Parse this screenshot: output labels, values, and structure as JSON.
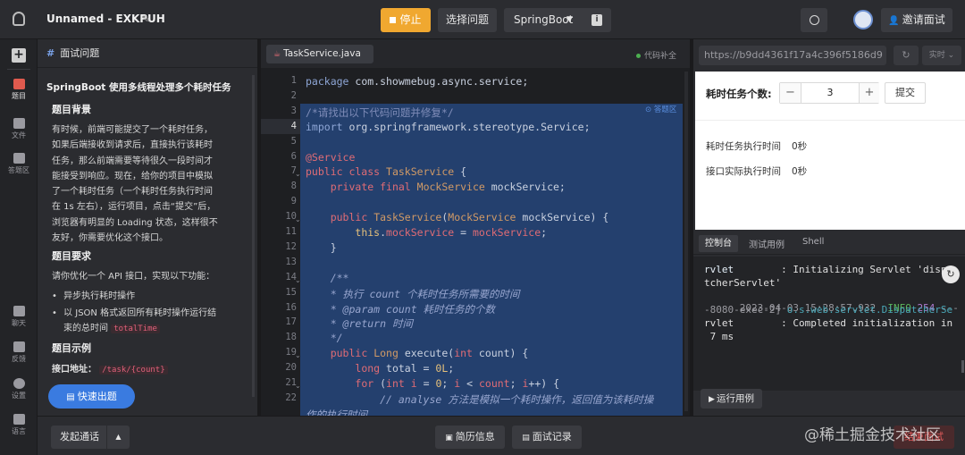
{
  "topbar": {
    "title": "Unnamed - EXKPUH",
    "stop_label": "停止",
    "select_problem_label": "选择问题",
    "language_label": "SpringBoot",
    "invite_label": "邀请面试"
  },
  "rail": {
    "items": [
      {
        "label": "题目"
      },
      {
        "label": "文件"
      },
      {
        "label": "答题区"
      },
      {
        "label": "聊天"
      },
      {
        "label": "反馈"
      },
      {
        "label": "设置"
      },
      {
        "label": "语言"
      }
    ]
  },
  "problem": {
    "header": "面试问题",
    "title": "SpringBoot 使用多线程处理多个耗时任务",
    "bg_heading": "题目背景",
    "bg_lines": [
      "有时候，前端可能提交了一个耗时任务，",
      "如果后端接收到请求后，直接执行该耗时",
      "任务，那么前端需要等待很久一段时间才",
      "能接受到响应。现在，给你的项目中模拟",
      "了一个耗时任务（一个耗时任务执行时间",
      "在 1s 左右），运行项目，点击“提交”后，",
      "浏览器有明显的 Loading 状态，这样很不",
      "友好，你需要优化这个接口。"
    ],
    "req_heading": "题目要求",
    "req_intro": "请你优化一个 API 接口，实现以下功能：",
    "req_item1": "异步执行耗时操作",
    "req_item2_line1": "以 JSON 格式返回所有耗时操作运行结",
    "req_item2_line2": "束的总时间",
    "req_item2_code": "totalTime",
    "example_heading": "题目示例",
    "api_label": "接口地址：",
    "api_path": "/task/{count}",
    "quick_button": "快速出题"
  },
  "editor": {
    "tab_label": "TaskService.java",
    "completion_label": "代码补全",
    "answer_area_label": "答题区",
    "lines": [
      {
        "n": "1",
        "html": "<span class='pk'>package</span> com.showmebug.async.service;"
      },
      {
        "n": "2",
        "html": ""
      },
      {
        "n": "3",
        "html": "<span class='cm'>/*请找出以下代码问题并修复*/</span>"
      },
      {
        "n": "4",
        "html": "<span class='pk'>import</span> org.springframework.stereotype.Service;"
      },
      {
        "n": "5",
        "html": ""
      },
      {
        "n": "6",
        "html": "<span class='an'>@Service</span>"
      },
      {
        "n": "7",
        "html": "<span class='kw'>public class</span> <span class='ty'>TaskService</span> {"
      },
      {
        "n": "8",
        "html": "    <span class='kw'>private final</span> <span class='ty'>MockService</span> mockService;"
      },
      {
        "n": "9",
        "html": ""
      },
      {
        "n": "10",
        "html": "    <span class='kw'>public</span> <span class='ty'>TaskService</span>(<span class='ty'>MockService</span> mockService) {"
      },
      {
        "n": "11",
        "html": "        <span class='pm'>this</span>.<span class='fd'>mockService</span> = <span class='fd'>mockService</span>;"
      },
      {
        "n": "12",
        "html": "    }"
      },
      {
        "n": "13",
        "html": ""
      },
      {
        "n": "14",
        "html": "    <span class='cmt'>/**</span>"
      },
      {
        "n": "15",
        "html": "    <span class='cmt'>* 执行 count 个耗时任务所需要的时间</span>"
      },
      {
        "n": "16",
        "html": "    <span class='cmt'>* @param count 耗时任务的个数</span>"
      },
      {
        "n": "17",
        "html": "    <span class='cmt'>* @return 时间</span>"
      },
      {
        "n": "18",
        "html": "    <span class='cmt'>*/</span>"
      },
      {
        "n": "19",
        "html": "    <span class='kw'>public</span> <span class='ty'>Long</span> execute(<span class='kw'>int</span> count) {"
      },
      {
        "n": "20",
        "html": "        <span class='kw'>long</span> total = <span class='nu'>0L</span>;"
      },
      {
        "n": "21",
        "html": "        <span class='kw'>for</span> (<span class='kw'>int</span> <span class='fd'>i</span> = <span class='nu'>0</span>; <span class='fd'>i</span> &lt; <span class='fd'>count</span>; <span class='fd'>i</span>++) {"
      },
      {
        "n": "22",
        "html": "            <span class='cmt'>// analyse 方法是模拟一个耗时操作，返回值为该耗时操</span>"
      },
      {
        "n": "",
        "html": "<span class='cmt'>作的执行时间</span>"
      }
    ]
  },
  "preview": {
    "url": "https://b9dd4361f17a4c396f5186d9",
    "realtime_label": "实时",
    "count_label": "耗时任务个数:",
    "count_value": "3",
    "minus": "−",
    "plus": "+",
    "submit_label": "提交",
    "exec_time_label": "耗时任务执行时间",
    "exec_time_value": "0秒",
    "actual_time_label": "接口实际执行时间",
    "actual_time_value": "0秒"
  },
  "console": {
    "tabs": [
      "控制台",
      "测试用例",
      "Shell"
    ],
    "line1": "rvlet        : Initializing Servlet 'dispa",
    "line2": "tcherServlet'",
    "line3_ts": "2023-04-03 15:28:57.932",
    "line3_level": "INFO",
    "line3_pid": "254",
    "line3_rest": " --- [nio",
    "line4": "-8080-exec-2] ",
    "line4_cls": "o.s.web.servlet.DispatcherSe",
    "line5": "rvlet        : Completed initialization in",
    "line6": " 7 ms",
    "run_cases_label": "运行用例"
  },
  "bottombar": {
    "start_call_label": "发起通话",
    "resume_label": "简历信息",
    "records_label": "面试记录",
    "end_label": "结束面试",
    "watermark": "@稀土掘金技术社区"
  },
  "colors": {
    "stop_button": "#f0a830",
    "quick_button": "#3a7be0",
    "selection": "#24406e"
  }
}
